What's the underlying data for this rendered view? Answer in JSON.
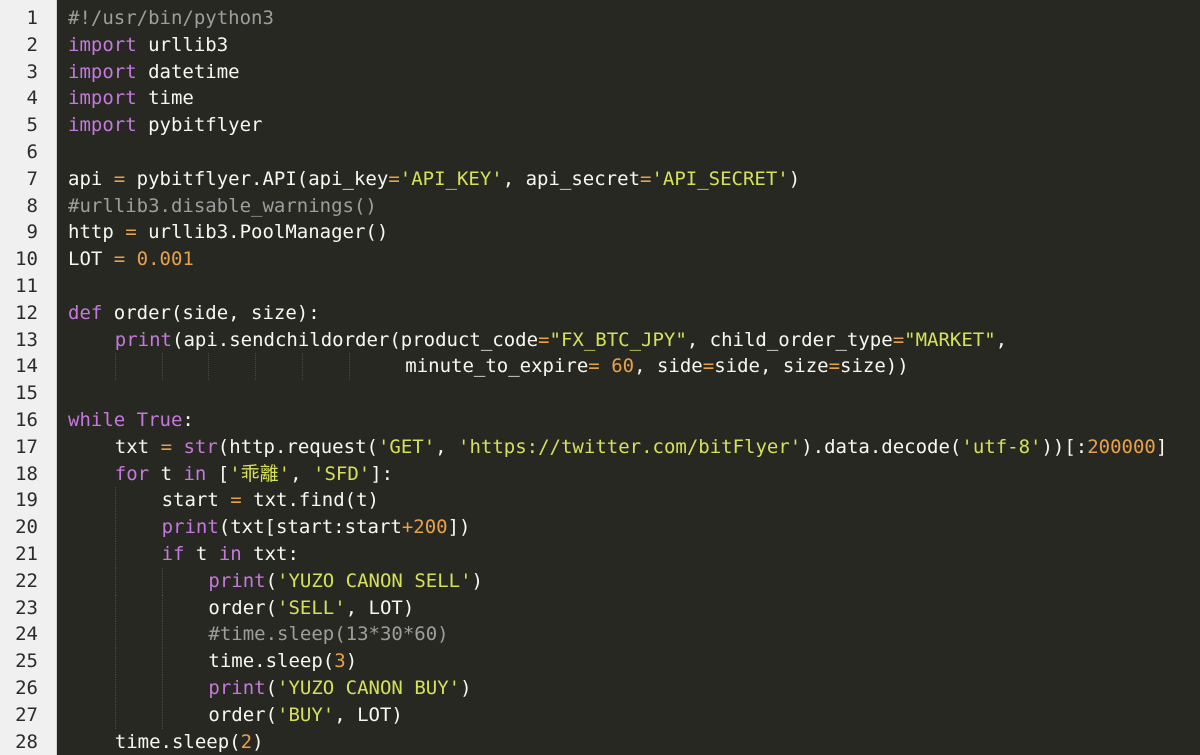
{
  "colors": {
    "background": "#272822",
    "gutter_background": "#f0f0f0",
    "line_number": "#2b2b2b",
    "default": "#f8f8f2",
    "keyword": "#c678dd",
    "builtin": "#c678dd",
    "string": "#d6e05a",
    "number": "#e6a14c",
    "operator": "#e6a14c",
    "comment": "#9e9e9e",
    "boolean": "#c678dd"
  },
  "editor": {
    "lines": [
      {
        "n": "1",
        "indent": 0,
        "tokens": [
          {
            "t": "#!/usr/bin/python3",
            "c": "comment"
          }
        ]
      },
      {
        "n": "2",
        "indent": 0,
        "tokens": [
          {
            "t": "import",
            "c": "keyword"
          },
          {
            "t": " urllib3",
            "c": "default"
          }
        ]
      },
      {
        "n": "3",
        "indent": 0,
        "tokens": [
          {
            "t": "import",
            "c": "keyword"
          },
          {
            "t": " datetime",
            "c": "default"
          }
        ]
      },
      {
        "n": "4",
        "indent": 0,
        "tokens": [
          {
            "t": "import",
            "c": "keyword"
          },
          {
            "t": " time",
            "c": "default"
          }
        ]
      },
      {
        "n": "5",
        "indent": 0,
        "tokens": [
          {
            "t": "import",
            "c": "keyword"
          },
          {
            "t": " pybitflyer",
            "c": "default"
          }
        ]
      },
      {
        "n": "6",
        "indent": 0,
        "tokens": []
      },
      {
        "n": "7",
        "indent": 0,
        "tokens": [
          {
            "t": "api ",
            "c": "default"
          },
          {
            "t": "=",
            "c": "operator"
          },
          {
            "t": " pybitflyer.API(api_key",
            "c": "default"
          },
          {
            "t": "=",
            "c": "operator"
          },
          {
            "t": "'API_KEY'",
            "c": "string"
          },
          {
            "t": ", api_secret",
            "c": "default"
          },
          {
            "t": "=",
            "c": "operator"
          },
          {
            "t": "'API_SECRET'",
            "c": "string"
          },
          {
            "t": ")",
            "c": "default"
          }
        ]
      },
      {
        "n": "8",
        "indent": 0,
        "tokens": [
          {
            "t": "#urllib3.disable_warnings()",
            "c": "comment"
          }
        ]
      },
      {
        "n": "9",
        "indent": 0,
        "tokens": [
          {
            "t": "http ",
            "c": "default"
          },
          {
            "t": "=",
            "c": "operator"
          },
          {
            "t": " urllib3.PoolManager()",
            "c": "default"
          }
        ]
      },
      {
        "n": "10",
        "indent": 0,
        "tokens": [
          {
            "t": "LOT ",
            "c": "default"
          },
          {
            "t": "=",
            "c": "operator"
          },
          {
            "t": " ",
            "c": "default"
          },
          {
            "t": "0.001",
            "c": "number"
          }
        ]
      },
      {
        "n": "11",
        "indent": 0,
        "tokens": []
      },
      {
        "n": "12",
        "indent": 0,
        "tokens": [
          {
            "t": "def",
            "c": "keyword"
          },
          {
            "t": " order(side, size):",
            "c": "default"
          }
        ]
      },
      {
        "n": "13",
        "indent": 1,
        "tokens": [
          {
            "t": "print",
            "c": "builtin"
          },
          {
            "t": "(api.sendchildorder(product_code",
            "c": "default"
          },
          {
            "t": "=",
            "c": "operator"
          },
          {
            "t": "\"FX_BTC_JPY\"",
            "c": "string"
          },
          {
            "t": ", child_order_type",
            "c": "default"
          },
          {
            "t": "=",
            "c": "operator"
          },
          {
            "t": "\"MARKET\"",
            "c": "string"
          },
          {
            "t": ",",
            "c": "default"
          }
        ]
      },
      {
        "n": "14",
        "indent": 7,
        "pad": 9.7,
        "tokens": [
          {
            "t": "minute_to_expire",
            "c": "default"
          },
          {
            "t": "=",
            "c": "operator"
          },
          {
            "t": " ",
            "c": "default"
          },
          {
            "t": "60",
            "c": "number"
          },
          {
            "t": ", side",
            "c": "default"
          },
          {
            "t": "=",
            "c": "operator"
          },
          {
            "t": "side, size",
            "c": "default"
          },
          {
            "t": "=",
            "c": "operator"
          },
          {
            "t": "size))",
            "c": "default"
          }
        ]
      },
      {
        "n": "15",
        "indent": 0,
        "tokens": []
      },
      {
        "n": "16",
        "indent": 0,
        "tokens": [
          {
            "t": "while",
            "c": "keyword"
          },
          {
            "t": " ",
            "c": "default"
          },
          {
            "t": "True",
            "c": "boolean"
          },
          {
            "t": ":",
            "c": "default"
          }
        ]
      },
      {
        "n": "17",
        "indent": 1,
        "tokens": [
          {
            "t": "txt ",
            "c": "default"
          },
          {
            "t": "=",
            "c": "operator"
          },
          {
            "t": " ",
            "c": "default"
          },
          {
            "t": "str",
            "c": "builtin"
          },
          {
            "t": "(http.request(",
            "c": "default"
          },
          {
            "t": "'GET'",
            "c": "string"
          },
          {
            "t": ", ",
            "c": "default"
          },
          {
            "t": "'https://twitter.com/bitFlyer'",
            "c": "string"
          },
          {
            "t": ").data.decode(",
            "c": "default"
          },
          {
            "t": "'utf-8'",
            "c": "string"
          },
          {
            "t": "))[:",
            "c": "default"
          },
          {
            "t": "200000",
            "c": "number"
          },
          {
            "t": "]",
            "c": "default"
          }
        ]
      },
      {
        "n": "18",
        "indent": 1,
        "tokens": [
          {
            "t": "for",
            "c": "keyword"
          },
          {
            "t": " t ",
            "c": "default"
          },
          {
            "t": "in",
            "c": "keyword"
          },
          {
            "t": " [",
            "c": "default"
          },
          {
            "t": "'乖離'",
            "c": "string"
          },
          {
            "t": ", ",
            "c": "default"
          },
          {
            "t": "'SFD'",
            "c": "string"
          },
          {
            "t": "]:",
            "c": "default"
          }
        ]
      },
      {
        "n": "19",
        "indent": 2,
        "tokens": [
          {
            "t": "start ",
            "c": "default"
          },
          {
            "t": "=",
            "c": "operator"
          },
          {
            "t": " txt.find(t)",
            "c": "default"
          }
        ]
      },
      {
        "n": "20",
        "indent": 2,
        "tokens": [
          {
            "t": "print",
            "c": "builtin"
          },
          {
            "t": "(txt[start:start",
            "c": "default"
          },
          {
            "t": "+",
            "c": "operator"
          },
          {
            "t": "200",
            "c": "number"
          },
          {
            "t": "])",
            "c": "default"
          }
        ]
      },
      {
        "n": "21",
        "indent": 2,
        "tokens": [
          {
            "t": "if",
            "c": "keyword"
          },
          {
            "t": " t ",
            "c": "default"
          },
          {
            "t": "in",
            "c": "keyword"
          },
          {
            "t": " txt:",
            "c": "default"
          }
        ]
      },
      {
        "n": "22",
        "indent": 3,
        "tokens": [
          {
            "t": "print",
            "c": "builtin"
          },
          {
            "t": "(",
            "c": "default"
          },
          {
            "t": "'YUZO CANON SELL'",
            "c": "string"
          },
          {
            "t": ")",
            "c": "default"
          }
        ]
      },
      {
        "n": "23",
        "indent": 3,
        "tokens": [
          {
            "t": "order(",
            "c": "default"
          },
          {
            "t": "'SELL'",
            "c": "string"
          },
          {
            "t": ", LOT)",
            "c": "default"
          }
        ]
      },
      {
        "n": "24",
        "indent": 3,
        "tokens": [
          {
            "t": "#time.sleep(13*30*60)",
            "c": "comment"
          }
        ]
      },
      {
        "n": "25",
        "indent": 3,
        "tokens": [
          {
            "t": "time.sleep(",
            "c": "default"
          },
          {
            "t": "3",
            "c": "number"
          },
          {
            "t": ")",
            "c": "default"
          }
        ]
      },
      {
        "n": "26",
        "indent": 3,
        "tokens": [
          {
            "t": "print",
            "c": "builtin"
          },
          {
            "t": "(",
            "c": "default"
          },
          {
            "t": "'YUZO CANON BUY'",
            "c": "string"
          },
          {
            "t": ")",
            "c": "default"
          }
        ]
      },
      {
        "n": "27",
        "indent": 3,
        "tokens": [
          {
            "t": "order(",
            "c": "default"
          },
          {
            "t": "'BUY'",
            "c": "string"
          },
          {
            "t": ", LOT)",
            "c": "default"
          }
        ]
      },
      {
        "n": "28",
        "indent": 1,
        "tokens": [
          {
            "t": "time.sleep(",
            "c": "default"
          },
          {
            "t": "2",
            "c": "number"
          },
          {
            "t": ")",
            "c": "default"
          }
        ]
      }
    ]
  }
}
